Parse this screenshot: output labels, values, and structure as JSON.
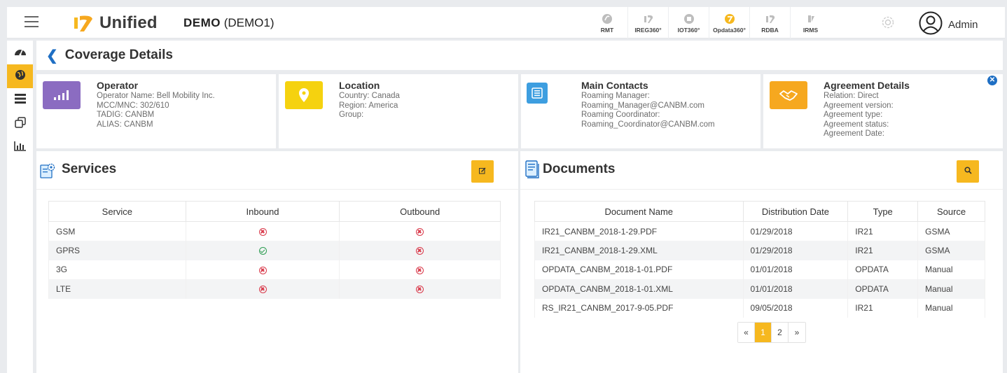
{
  "brand": {
    "name": "Unified",
    "workspace_code": "DEMO",
    "workspace_id": "(DEMO1)"
  },
  "apps": [
    {
      "label": "RMT",
      "icon": "rmt-icon",
      "color": "#bdbdbd"
    },
    {
      "label": "IREG360°",
      "icon": "ireg360-icon",
      "color": "#bdbdbd"
    },
    {
      "label": "IOT360°",
      "icon": "iot360-icon",
      "color": "#bdbdbd"
    },
    {
      "label": "Opdata360°",
      "icon": "opdata360-icon",
      "color": "#f6b81f"
    },
    {
      "label": "RDBA",
      "icon": "rdba-icon",
      "color": "#bdbdbd"
    },
    {
      "label": "IRMS",
      "icon": "irms-icon",
      "color": "#bdbdbd"
    }
  ],
  "user": {
    "name": "Admin"
  },
  "page": {
    "title": "Coverage Details"
  },
  "cards": {
    "operator": {
      "title": "Operator",
      "lines": [
        "Operator Name: Bell Mobility Inc.",
        "MCC/MNC: 302/610",
        "TADIG: CANBM",
        "ALIAS: CANBM"
      ],
      "color": "#8b6cc1"
    },
    "location": {
      "title": "Location",
      "lines": [
        "Country: Canada",
        "Region: America",
        "Group:"
      ],
      "color": "#f5d20f"
    },
    "contacts": {
      "title": "Main Contacts",
      "lines": [
        "Roaming Manager:",
        "Roaming_Manager@CANBM.com",
        "Roaming Coordinator:",
        "Roaming_Coordinator@CANBM.com"
      ],
      "color": "#3d9ee0"
    },
    "agreement": {
      "title": "Agreement Details",
      "lines": [
        "Relation: Direct",
        "Agreement version:",
        "Agreement type:",
        "Agreement status:",
        "Agreement Date:"
      ],
      "color": "#f6a81f"
    }
  },
  "services": {
    "title": "Services",
    "headers": [
      "Service",
      "Inbound",
      "Outbound"
    ],
    "rows": [
      {
        "service": "GSM",
        "inbound": "no",
        "outbound": "no"
      },
      {
        "service": "GPRS",
        "inbound": "yes",
        "outbound": "no"
      },
      {
        "service": "3G",
        "inbound": "no",
        "outbound": "no"
      },
      {
        "service": "LTE",
        "inbound": "no",
        "outbound": "no"
      }
    ]
  },
  "documents": {
    "title": "Documents",
    "headers": [
      "Document Name",
      "Distribution Date",
      "Type",
      "Source"
    ],
    "rows": [
      [
        "IR21_CANBM_2018-1-29.PDF",
        "01/29/2018",
        "IR21",
        "GSMA"
      ],
      [
        "IR21_CANBM_2018-1-29.XML",
        "01/29/2018",
        "IR21",
        "GSMA"
      ],
      [
        "OPDATA_CANBM_2018-1-01.PDF",
        "01/01/2018",
        "OPDATA",
        "Manual"
      ],
      [
        "OPDATA_CANBM_2018-1-01.XML",
        "01/01/2018",
        "OPDATA",
        "Manual"
      ],
      [
        "RS_IR21_CANBM_2017-9-05.PDF",
        "09/05/2018",
        "IR21",
        "Manual"
      ]
    ],
    "pagination": {
      "prev": "«",
      "pages": [
        "1",
        "2"
      ],
      "current": "1",
      "next": "»"
    }
  },
  "colors": {
    "accent": "#f6b81f",
    "link": "#1f6fc4",
    "error": "#d9394a",
    "success": "#2d9d52"
  }
}
